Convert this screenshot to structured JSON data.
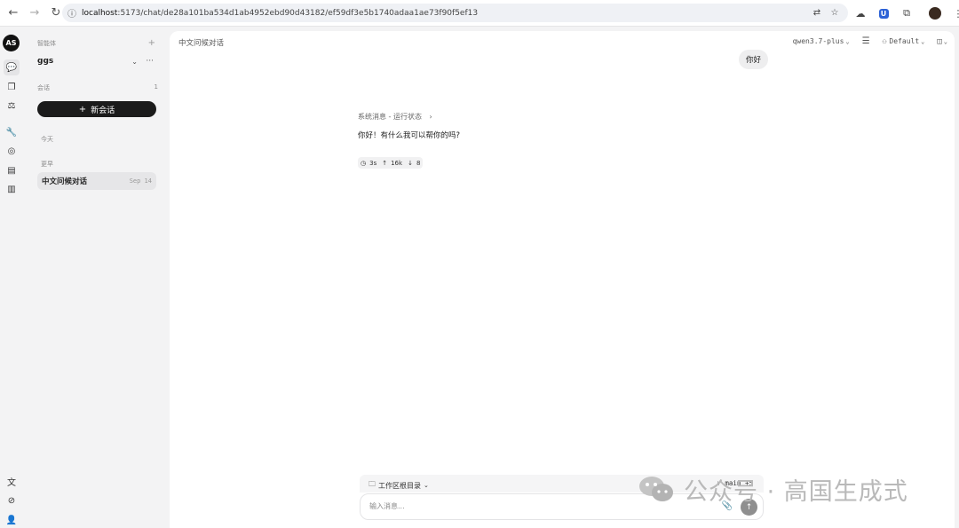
{
  "browser": {
    "url_host": "localhost",
    "url_rest": ":5173/chat/de28a101ba534d1ab4952ebd90d43182/ef59df3e5b1740adaa1ae73f90f5ef13"
  },
  "app": {
    "logo_text": "AS"
  },
  "sidebar": {
    "agent_label": "智能体",
    "agent_name": "ggs",
    "sessions_label": "会话",
    "sessions_count": "1",
    "new_chat_label": "新会话",
    "today_label": "今天",
    "earlier_label": "更早",
    "chat_items": [
      {
        "title": "中文问候对话",
        "date": "Sep 14"
      }
    ]
  },
  "main": {
    "title": "中文问候对话",
    "model": "qwen3.7-plus",
    "profile": "Default",
    "user_message": "你好",
    "system_line": "系统消息 - 运行状态",
    "assistant_message": "你好！有什么我可以帮你的吗?",
    "stats": {
      "time": "3s",
      "tokens_up": "16k",
      "tokens_down": "8"
    }
  },
  "composer": {
    "workspace_label": "工作区根目录",
    "branch": "main +5",
    "placeholder": "输入消息..."
  },
  "watermark": {
    "text": "公众号 · 高国生成式"
  },
  "colors": {
    "accent_dark": "#1b1b1b",
    "background": "#f3f3f4",
    "panel": "#ffffff"
  }
}
